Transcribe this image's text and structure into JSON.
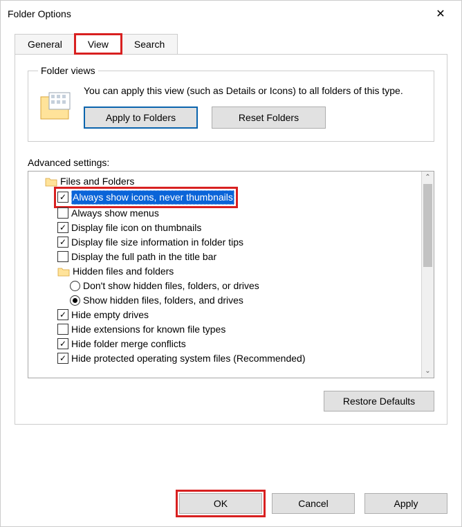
{
  "window": {
    "title": "Folder Options",
    "close_icon": "✕"
  },
  "tabs": {
    "general": "General",
    "view": "View",
    "search": "Search",
    "active": "view"
  },
  "folder_views": {
    "legend": "Folder views",
    "description": "You can apply this view (such as Details or Icons) to all folders of this type.",
    "apply_label": "Apply to Folders",
    "reset_label": "Reset Folders"
  },
  "advanced": {
    "label": "Advanced settings:",
    "tree": [
      {
        "type": "folder",
        "indent": 1,
        "label": "Files and Folders"
      },
      {
        "type": "check",
        "indent": 2,
        "checked": true,
        "selected": true,
        "highlight": true,
        "label": "Always show icons, never thumbnails"
      },
      {
        "type": "check",
        "indent": 2,
        "checked": false,
        "label": "Always show menus"
      },
      {
        "type": "check",
        "indent": 2,
        "checked": true,
        "label": "Display file icon on thumbnails"
      },
      {
        "type": "check",
        "indent": 2,
        "checked": true,
        "label": "Display file size information in folder tips"
      },
      {
        "type": "check",
        "indent": 2,
        "checked": false,
        "label": "Display the full path in the title bar"
      },
      {
        "type": "folder",
        "indent": 2,
        "label": "Hidden files and folders"
      },
      {
        "type": "radio",
        "indent": 3,
        "checked": false,
        "label": "Don't show hidden files, folders, or drives"
      },
      {
        "type": "radio",
        "indent": 3,
        "checked": true,
        "label": "Show hidden files, folders, and drives"
      },
      {
        "type": "check",
        "indent": 2,
        "checked": true,
        "label": "Hide empty drives"
      },
      {
        "type": "check",
        "indent": 2,
        "checked": false,
        "label": "Hide extensions for known file types"
      },
      {
        "type": "check",
        "indent": 2,
        "checked": true,
        "label": "Hide folder merge conflicts"
      },
      {
        "type": "check",
        "indent": 2,
        "checked": true,
        "label": "Hide protected operating system files (Recommended)"
      }
    ],
    "restore_label": "Restore Defaults"
  },
  "footer": {
    "ok_label": "OK",
    "cancel_label": "Cancel",
    "apply_label": "Apply"
  },
  "glyphs": {
    "check": "✓",
    "arrow_up": "⌃",
    "arrow_down": "⌄"
  }
}
